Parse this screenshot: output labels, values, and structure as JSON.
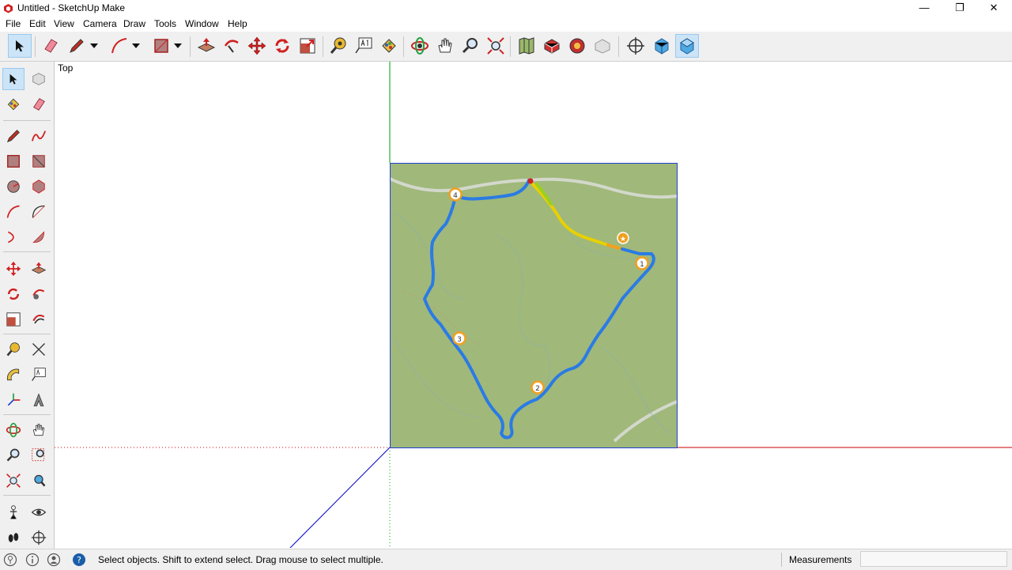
{
  "window": {
    "title": "Untitled - SketchUp Make",
    "controls": {
      "minimize": "—",
      "restore": "❐",
      "close": "✕"
    }
  },
  "menu": [
    "File",
    "Edit",
    "View",
    "Camera",
    "Draw",
    "Tools",
    "Window",
    "Help"
  ],
  "toolbar": {
    "icons": [
      "select-icon",
      "eraser-icon",
      "pencil-icon",
      "dropdown-arrow-icon",
      "arc-icon",
      "dropdown-arrow-icon",
      "rectangle-icon",
      "dropdown-arrow-icon",
      "push-pull-icon",
      "follow-me-icon",
      "move-icon",
      "rotate-icon",
      "scale-icon",
      "tape-measure-icon",
      "text-icon",
      "paint-bucket-icon",
      "orbit-icon",
      "pan-icon",
      "zoom-icon",
      "zoom-extents-icon",
      "add-location-icon",
      "get-models-icon",
      "share-model-icon",
      "extension-warehouse-icon",
      "position-camera-icon",
      "iso-view-icon",
      "top-view-icon"
    ]
  },
  "viewport": {
    "label": "Top",
    "map_markers": [
      "1",
      "2",
      "3",
      "4"
    ]
  },
  "colors": {
    "accent": "#0078d7",
    "axis_red": "#cc0000",
    "axis_green": "#00a000",
    "axis_blue": "#0000cc",
    "map_green": "#a0b87a",
    "route_blue": "#2a7be4"
  },
  "status": {
    "text": "Select objects. Shift to extend select. Drag mouse to select multiple.",
    "measurements_label": "Measurements",
    "measurements_value": ""
  }
}
